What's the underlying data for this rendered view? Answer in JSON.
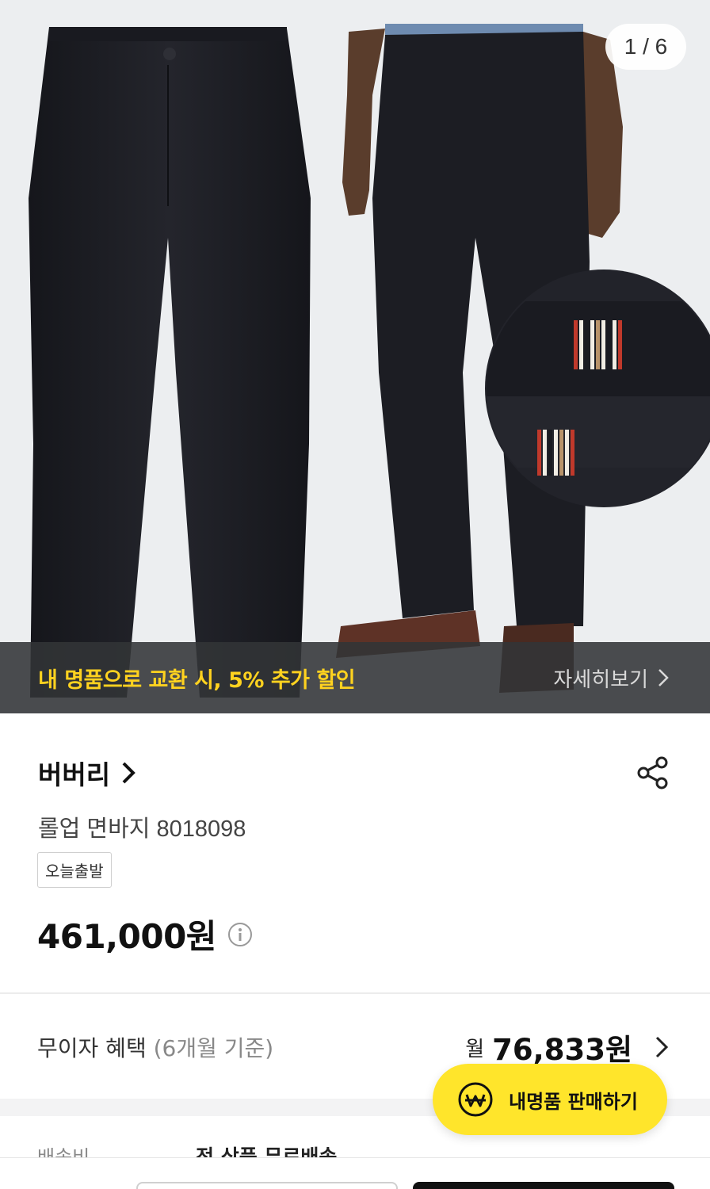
{
  "gallery": {
    "counter": "1 / 6",
    "promo_text": "내 명품으로 교환 시, 5% 추가 할인",
    "promo_more": "자세히보기"
  },
  "product": {
    "brand": "버버리",
    "name": "롤업 면바지 8018098",
    "badge": "오늘출발",
    "price": "461,000원"
  },
  "installment": {
    "label": "무이자 혜택",
    "label_note": "(6개월 기준)",
    "prefix": "월",
    "value": "76,833원"
  },
  "shipping": {
    "label": "배송비",
    "value": "전 상품 무료배송"
  },
  "sell_button": {
    "label": "내명품 판매하기",
    "icon": "won-coin-icon"
  },
  "colors": {
    "promo_yellow": "#ffd21f",
    "sell_button_bg": "#ffe52b",
    "pants": "#1d1e24"
  }
}
